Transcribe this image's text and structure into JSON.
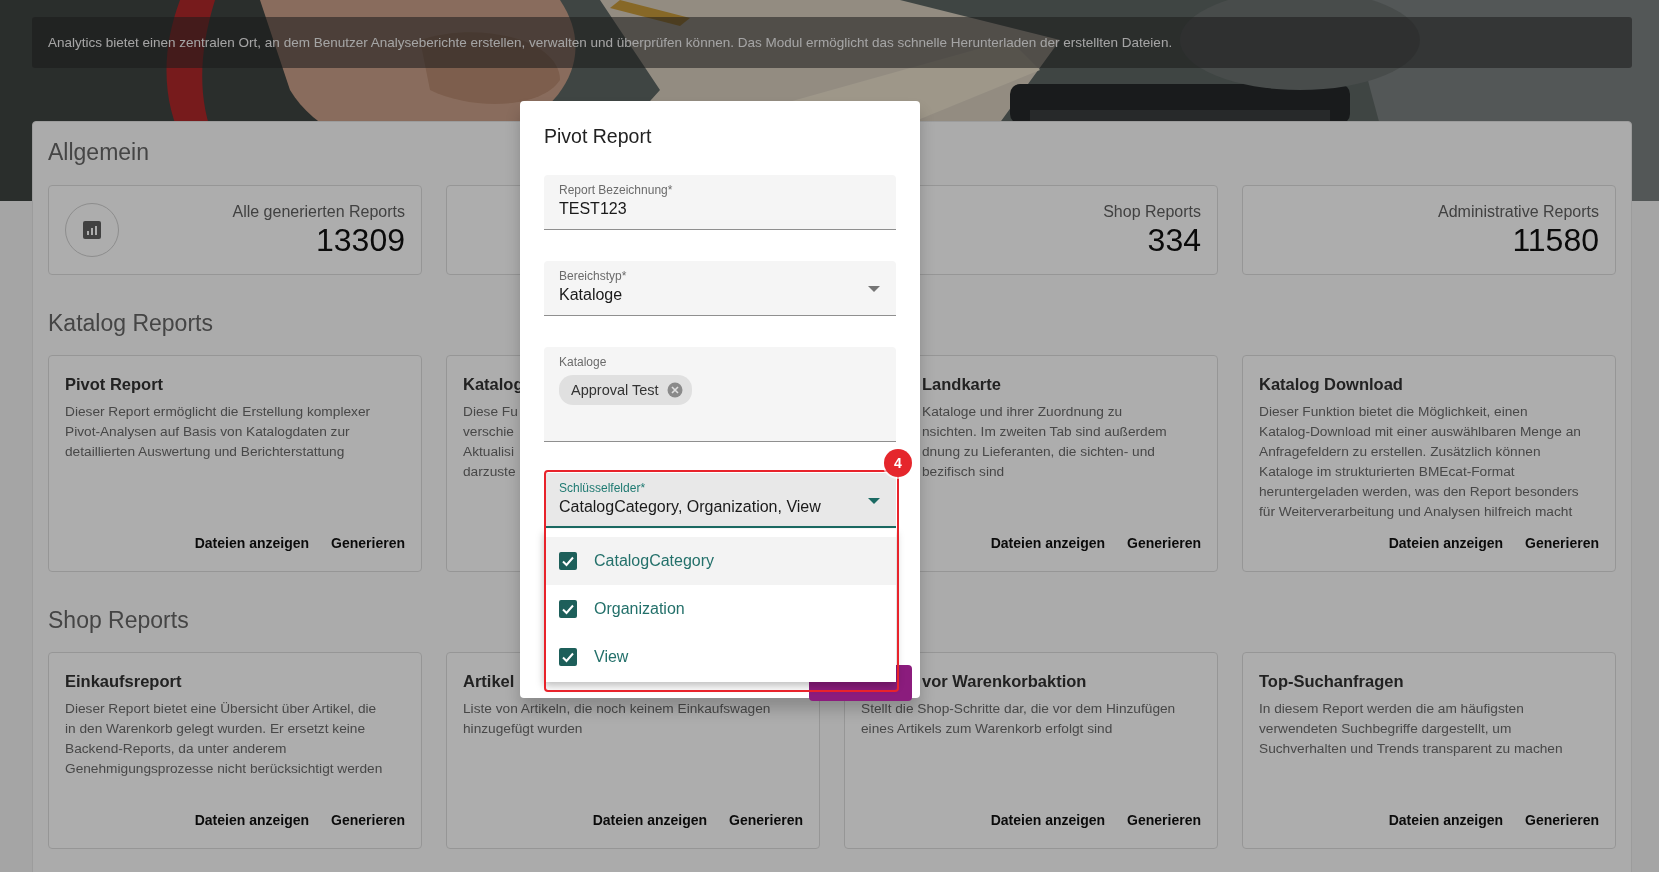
{
  "banner": {
    "text": "Analytics bietet einen zentralen Ort, an dem Benutzer Analyseberichte erstellen, verwalten und überprüfen können. Das Modul ermöglicht das schnelle Herunterladen der erstellten Dateien."
  },
  "sections": [
    {
      "title": "Allgemein",
      "kind": "stats",
      "cards": [
        {
          "kind": "stat",
          "label": "Alle generierten Reports",
          "value": "13309",
          "icon": true
        },
        {
          "kind": "empty"
        },
        {
          "kind": "stat",
          "label": "Shop Reports",
          "value": "334"
        },
        {
          "kind": "stat",
          "label": "Administrative Reports",
          "value": "11580"
        }
      ]
    },
    {
      "title": "Katalog Reports",
      "kind": "reports",
      "cards": [
        {
          "kind": "report",
          "title": "Pivot Report",
          "description": [
            "Dieser Report ermöglicht die Erstellung komplexer",
            "Pivot-Analysen auf Basis von Katalogdaten zur",
            "detaillierten Auswertung und Berichterstattung"
          ],
          "actions": [
            "Dateien anzeigen",
            "Generieren"
          ]
        },
        {
          "kind": "report",
          "title": "Katalog",
          "description": [
            "Diese Fu",
            "verschie",
            "Aktualisi",
            "darzuste"
          ]
        },
        {
          "kind": "offset",
          "title": "Landkarte",
          "description": [
            "Kataloge und ihrer Zuordnung zu",
            "nsichten. Im zweiten Tab sind außerdem",
            "dnung zu Lieferanten, die sichten- und",
            "bezifisch sind"
          ],
          "actions": [
            "Dateien anzeigen",
            "Generieren"
          ]
        },
        {
          "kind": "report",
          "title": "Katalog Download",
          "description": [
            "Dieser Funktion bietet die Möglichkeit, einen",
            "Katalog-Download mit einer auswählbaren Menge an",
            "Anfragefeldern zu erstellen. Zusätzlich können",
            "Kataloge im strukturierten BMEcat-Format",
            "heruntergeladen werden, was den Report besonders",
            "für Weiterverarbeitung und Analysen hilfreich macht"
          ],
          "actions": [
            "Dateien anzeigen",
            "Generieren"
          ]
        }
      ]
    },
    {
      "title": "Shop Reports",
      "kind": "reports",
      "cards": [
        {
          "kind": "report",
          "title": "Einkaufsreport",
          "description": [
            "Dieser Report bietet eine Übersicht über Artikel, die",
            "in den Warenkorb gelegt wurden. Er ersetzt keine",
            "Backend-Reports, da unter anderem",
            "Genehmigungsprozesse nicht berücksichtigt werden"
          ],
          "actions": [
            "Dateien anzeigen",
            "Generieren"
          ]
        },
        {
          "kind": "report",
          "title": "Artikel",
          "description": [
            "Liste von Artikeln, die noch keinem Einkaufswagen",
            "hinzugefügt wurden"
          ],
          "actions": [
            "Dateien anzeigen",
            "Generieren"
          ]
        },
        {
          "kind": "title_offset",
          "title": "vor Warenkorbaktion",
          "description": [
            "Stellt die Shop-Schritte dar, die vor dem Hinzufügen",
            "eines Artikels zum Warenkorb erfolgt sind"
          ],
          "actions": [
            "Dateien anzeigen",
            "Generieren"
          ]
        },
        {
          "kind": "report",
          "title": "Top-Suchanfragen",
          "description": [
            "In diesem Report werden die am häufigsten",
            "verwendeten Suchbegriffe dargestellt, um",
            "Suchverhalten und Trends transparent zu machen"
          ],
          "actions": [
            "Dateien anzeigen",
            "Generieren"
          ]
        }
      ]
    }
  ],
  "dialog": {
    "title": "Pivot Report",
    "fields": [
      {
        "kind": "text",
        "label": "Report Bezeichnung*",
        "value": "TEST123",
        "focused": false
      },
      {
        "kind": "select",
        "label": "Bereichstyp*",
        "value": "Kataloge",
        "focused": false
      },
      {
        "kind": "chips",
        "label": "Kataloge",
        "chips": [
          "Approval Test"
        ],
        "focused": false
      },
      {
        "kind": "select",
        "label": "Schlüsselfelder*",
        "value": "CatalogCategory, Organization, View",
        "focused": true
      }
    ],
    "dropdown": {
      "options": [
        {
          "label": "CatalogCategory",
          "checked": true,
          "highlighted": true
        },
        {
          "label": "Organization",
          "checked": true,
          "highlighted": false
        },
        {
          "label": "View",
          "checked": true,
          "highlighted": false
        }
      ]
    },
    "annotation": {
      "badge": "4"
    }
  }
}
